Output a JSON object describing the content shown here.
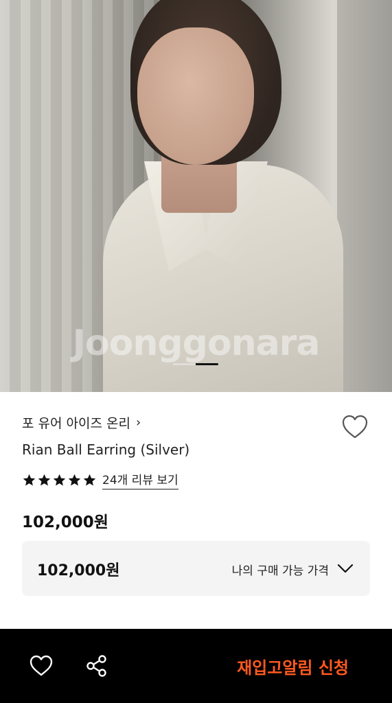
{
  "hero": {
    "watermark": "Joonggonara",
    "carousel": {
      "total": 2,
      "current": 2
    }
  },
  "product": {
    "brand": "포 유어 아이즈 온리",
    "brand_chevron": "›",
    "title": "Rian Ball Earring (Silver)",
    "rating": {
      "stars": 5,
      "max": 5
    },
    "review_link": "24개 리뷰 보기",
    "price": "102,000원"
  },
  "price_box": {
    "value": "102,000원",
    "label": "나의 구매 가능 가격"
  },
  "bottom_bar": {
    "cta": "재입고알림 신청"
  },
  "colors": {
    "accent": "#ff5a1f",
    "bottom_bar_bg": "#000000",
    "price_box_bg": "#f4f4f4"
  },
  "icons": {
    "wishlist_top": "heart-outline-icon",
    "brand_chevron": "chevron-right-icon",
    "price_box": "chevron-down-icon",
    "bottom_heart": "heart-outline-icon",
    "bottom_share": "share-icon",
    "rating": "star-icon"
  }
}
